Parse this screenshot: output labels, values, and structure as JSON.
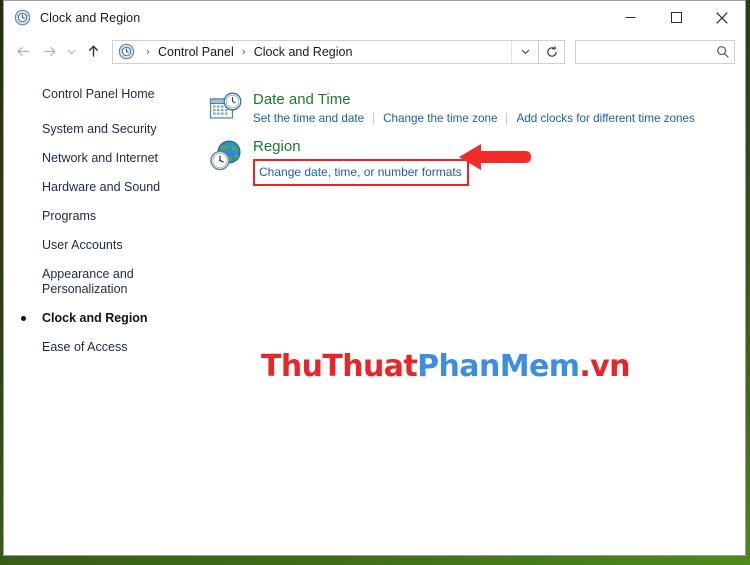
{
  "window": {
    "title": "Clock and Region",
    "title_icon": "clock-region-icon",
    "controls": {
      "minimize": "–",
      "maximize": "□",
      "close": "✕"
    }
  },
  "toolbar": {
    "back_icon": "back-arrow-icon",
    "forward_icon": "forward-arrow-icon",
    "recent_icon": "recent-pages-chevron-icon",
    "up_icon": "up-arrow-icon",
    "breadcrumb_icon": "clock-region-icon",
    "breadcrumb": [
      {
        "label": "Control Panel"
      },
      {
        "label": "Clock and Region"
      }
    ],
    "separator": "›",
    "dropdown_icon": "chevron-down-icon",
    "refresh_icon": "refresh-icon",
    "search": {
      "value": "",
      "placeholder": "",
      "icon": "search-icon"
    }
  },
  "sidebar": {
    "home": {
      "label": "Control Panel Home"
    },
    "items": [
      {
        "label": "System and Security",
        "current": false
      },
      {
        "label": "Network and Internet",
        "current": false
      },
      {
        "label": "Hardware and Sound",
        "current": false
      },
      {
        "label": "Programs",
        "current": false
      },
      {
        "label": "User Accounts",
        "current": false
      },
      {
        "label": "Appearance and Personalization",
        "current": false
      },
      {
        "label": "Clock and Region",
        "current": true
      },
      {
        "label": "Ease of Access",
        "current": false
      }
    ]
  },
  "content": {
    "categories": [
      {
        "icon": "date-and-time-icon",
        "title": "Date and Time",
        "links": [
          "Set the time and date",
          "Change the time zone",
          "Add clocks for different time zones"
        ]
      },
      {
        "icon": "region-globe-clock-icon",
        "title": "Region",
        "links": [
          "Change date, time, or number formats"
        ]
      }
    ]
  },
  "annotations": {
    "highlight_color": "#ef2222",
    "arrow_color": "#f22b2b",
    "arrow_direction": "left",
    "arrow_target": "Change date, time, or number formats"
  },
  "watermark": {
    "part1": "ThuThuat",
    "part2": "PhanMem",
    "part3": ".vn",
    "color1": "#e8262a",
    "color2": "#3d8ee0",
    "color3": "#e8262a"
  }
}
